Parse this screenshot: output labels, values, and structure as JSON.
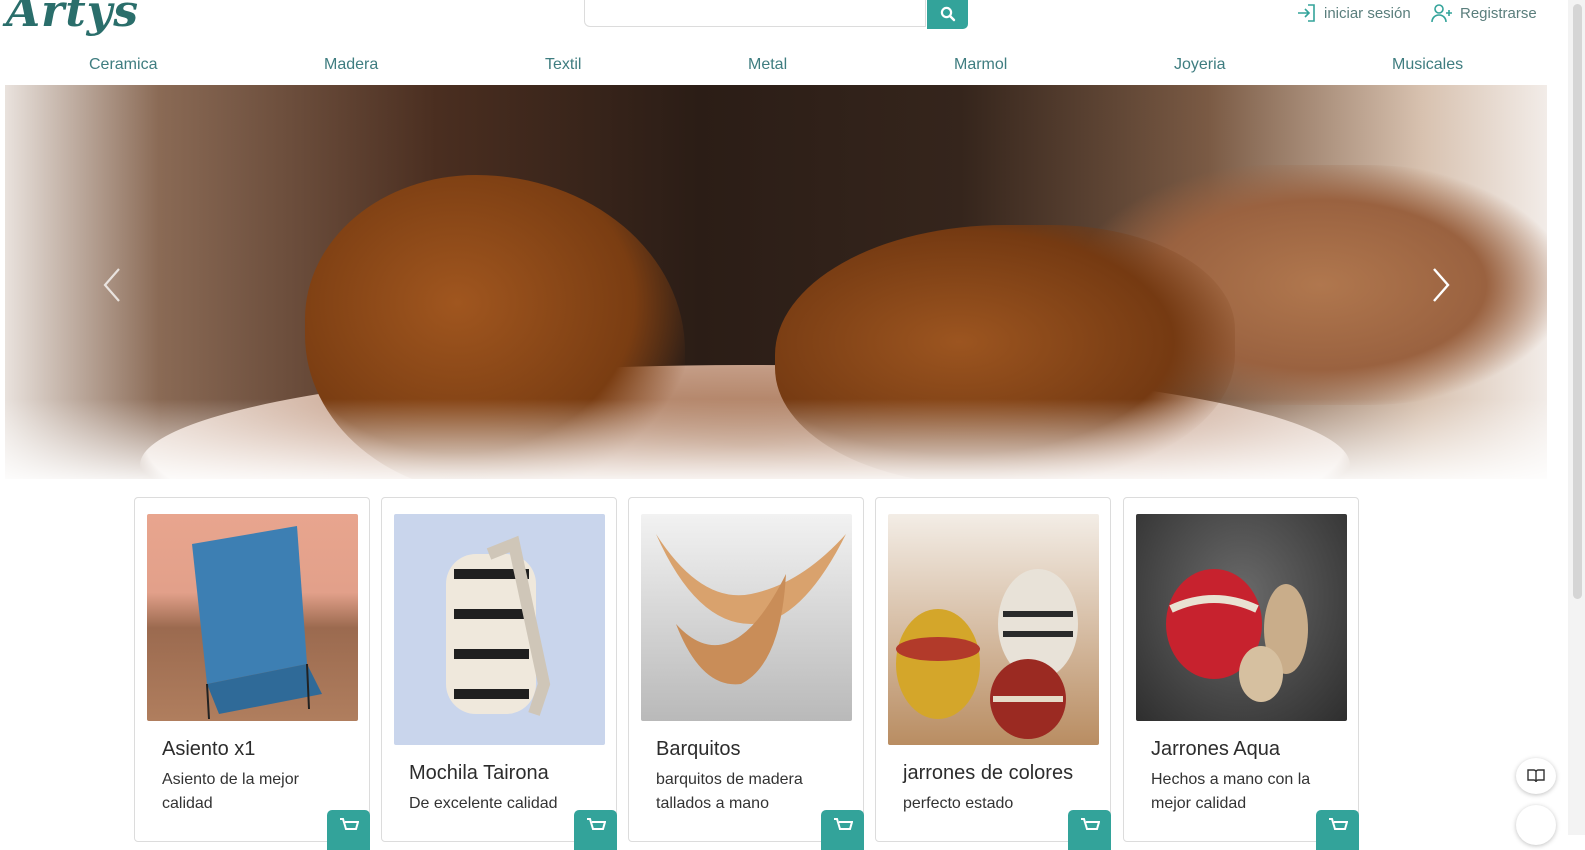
{
  "brand": {
    "logo_text": "Artys"
  },
  "search": {
    "placeholder": "",
    "value": "",
    "icon": "search-icon"
  },
  "auth": {
    "login_label": "iniciar sesión",
    "register_label": "Registrarse"
  },
  "nav": {
    "categories": [
      "Ceramica",
      "Madera",
      "Textil",
      "Metal",
      "Marmol",
      "Joyeria",
      "Musicales"
    ]
  },
  "colors": {
    "accent": "#33a39a",
    "nav_text": "#3f7d80",
    "logo": "#2a6e6b"
  },
  "products": [
    {
      "title": "Asiento x1",
      "description": "Asiento de la mejor calidad"
    },
    {
      "title": "Mochila Tairona",
      "description": "De excelente calidad"
    },
    {
      "title": "Barquitos",
      "description": "barquitos de madera tallados a mano"
    },
    {
      "title": "jarrones de colores",
      "description": "perfecto estado"
    },
    {
      "title": "Jarrones Aqua",
      "description": "Hechos a mano con la mejor calidad"
    }
  ]
}
